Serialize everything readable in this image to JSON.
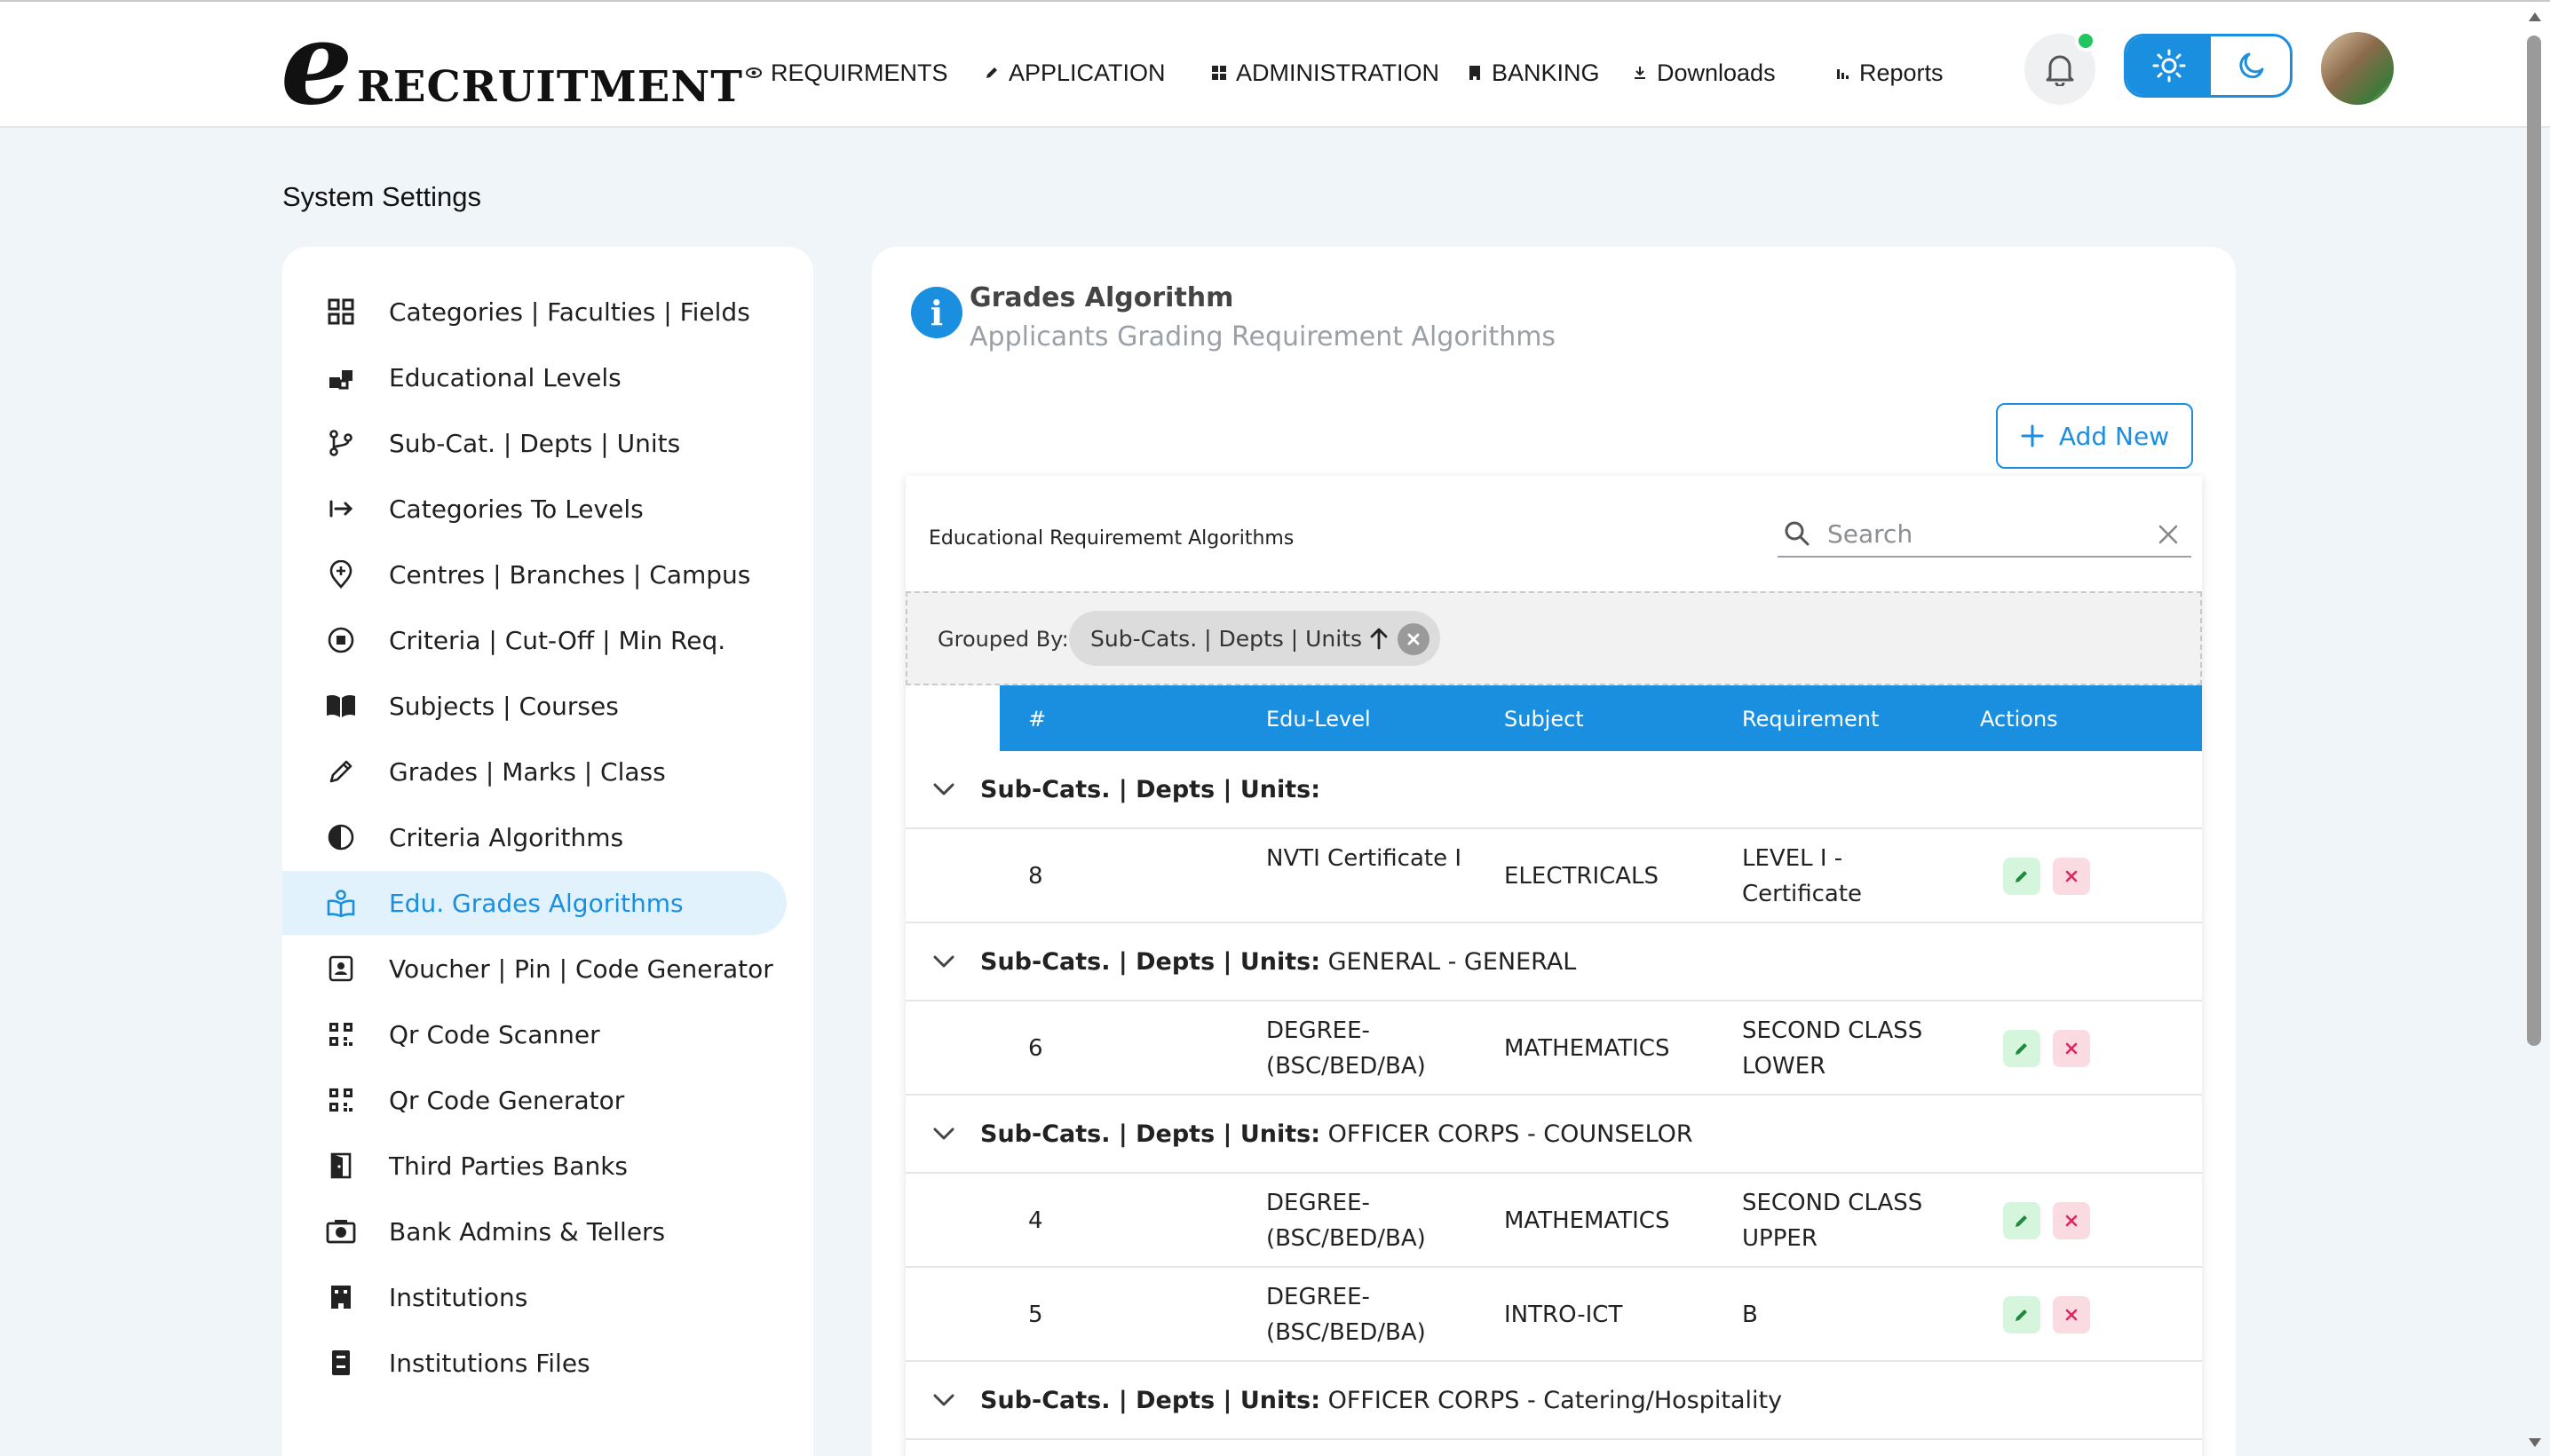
{
  "brand": {
    "logo_letter": "e",
    "logo_word": "RECRUITMENT"
  },
  "nav": [
    {
      "label": "REQUIRMENTS",
      "icon": "eye-icon"
    },
    {
      "label": "APPLICATION",
      "icon": "pencil-icon"
    },
    {
      "label": "ADMINISTRATION",
      "icon": "grid-icon"
    },
    {
      "label": "BANKING",
      "icon": "bank-icon"
    },
    {
      "label": "Downloads",
      "icon": "download-icon"
    },
    {
      "label": "Reports",
      "icon": "bar-chart-icon"
    }
  ],
  "header_icons": {
    "notification": "bell-icon",
    "light_theme": "sun-icon",
    "dark_theme": "moon-icon",
    "status_color": "#22c55e",
    "accent": "#1a8fe0"
  },
  "page": {
    "title": "System Settings"
  },
  "sidebar": {
    "items": [
      {
        "label": "Categories | Faculties | Fields",
        "icon": "grid-icon"
      },
      {
        "label": "Educational Levels",
        "icon": "blocks-icon"
      },
      {
        "label": "Sub-Cat. | Depts | Units",
        "icon": "branch-icon"
      },
      {
        "label": "Categories To Levels",
        "icon": "arrow-to-bar-icon"
      },
      {
        "label": "Centres | Branches | Campus",
        "icon": "location-add-icon"
      },
      {
        "label": "Criteria | Cut-Off | Min Req.",
        "icon": "stop-circle-icon"
      },
      {
        "label": "Subjects | Courses",
        "icon": "book-open-icon"
      },
      {
        "label": "Grades | Marks | Class",
        "icon": "pencil-icon"
      },
      {
        "label": "Criteria Algorithms",
        "icon": "contrast-icon"
      },
      {
        "label": "Edu. Grades Algorithms",
        "icon": "book-reader-icon",
        "active": true
      },
      {
        "label": "Voucher | Pin | Code Generator",
        "icon": "contact-card-icon"
      },
      {
        "label": "Qr Code Scanner",
        "icon": "qr-code-icon"
      },
      {
        "label": "Qr Code Generator",
        "icon": "qr-code-icon"
      },
      {
        "label": "Third Parties Banks",
        "icon": "door-icon"
      },
      {
        "label": "Bank Admins & Tellers",
        "icon": "camera-icon"
      },
      {
        "label": "Institutions",
        "icon": "building-icon"
      },
      {
        "label": "Institutions Files",
        "icon": "file-cabinet-icon"
      }
    ]
  },
  "card": {
    "title": "Grades Algorithm",
    "subtitle": "Applicants Grading Requirement Algorithms",
    "add_label": "Add New"
  },
  "grid": {
    "name": "Educational Requirememt Algorithms",
    "search_placeholder": "Search",
    "grouped_by_label": "Grouped By:",
    "group_chip": "Sub-Cats. | Depts | Units",
    "columns": [
      "#",
      "Edu-Level",
      "Subject",
      "Requirement",
      "Actions"
    ],
    "group_key": "Sub-Cats. | Depts | Units:",
    "groups": [
      {
        "value": "",
        "rows": [
          {
            "num": "8",
            "level": "NVTI Certificate I",
            "subject": "ELECTRICALS",
            "requirement": "LEVEL I - Certificate"
          }
        ]
      },
      {
        "value": " GENERAL - GENERAL",
        "rows": [
          {
            "num": "6",
            "level": "DEGREE-(BSC/BED/BA)",
            "subject": "MATHEMATICS",
            "requirement": "SECOND CLASS LOWER"
          }
        ]
      },
      {
        "value": " OFFICER CORPS - COUNSELOR",
        "rows": [
          {
            "num": "4",
            "level": "DEGREE-(BSC/BED/BA)",
            "subject": "MATHEMATICS",
            "requirement": "SECOND CLASS UPPER"
          },
          {
            "num": "5",
            "level": "DEGREE-(BSC/BED/BA)",
            "subject": "INTRO-ICT",
            "requirement": "B"
          }
        ]
      },
      {
        "value": " OFFICER CORPS - Catering/Hospitality",
        "rows": []
      }
    ]
  }
}
